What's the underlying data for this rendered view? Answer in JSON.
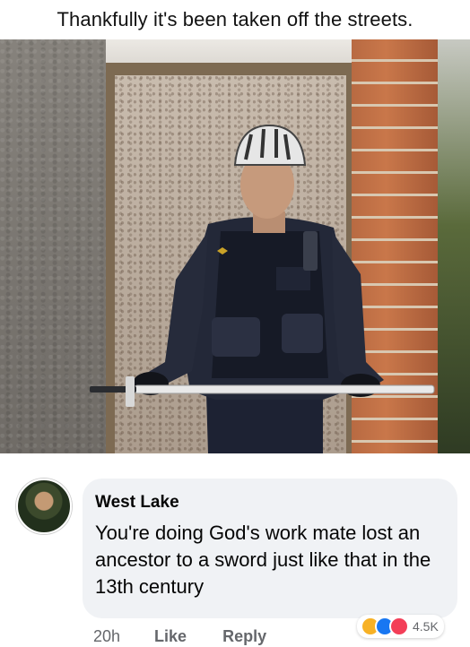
{
  "caption": "Thankfully it's been taken off the streets.",
  "comment": {
    "author": "West Lake",
    "text": "You're doing God's work mate lost an ancestor to a sword just like that in the 13th century",
    "time": "20h",
    "like_label": "Like",
    "reply_label": "Reply",
    "reaction_count": "4.5K",
    "reactions": [
      "haha-icon",
      "like-icon",
      "love-icon"
    ]
  },
  "colors": {
    "bubble": "#f0f2f5",
    "meta_text": "#65676b",
    "like_blue": "#1877f2",
    "love_red": "#f33e58",
    "haha_yellow": "#f7b125"
  }
}
